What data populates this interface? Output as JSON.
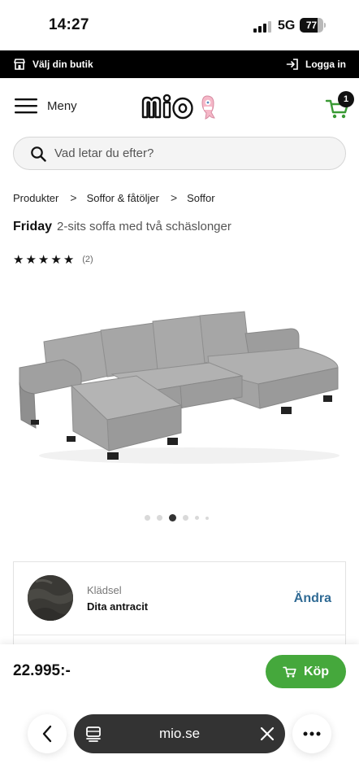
{
  "status_bar": {
    "time": "14:27",
    "network": "5G",
    "battery": "77",
    "battery_level": 0.77
  },
  "topbar": {
    "store_label": "Välj din butik",
    "store_icon": "store-icon",
    "login_label": "Logga in",
    "login_icon": "login-icon"
  },
  "header": {
    "menu_label": "Meny",
    "menu_icon": "hamburger-icon",
    "logo_text": "mio",
    "cart_icon": "cart-icon",
    "cart_count": "1"
  },
  "search": {
    "placeholder": "Vad letar du efter?",
    "icon": "search-icon"
  },
  "breadcrumb": {
    "items": [
      "Produkter",
      "Soffor & fåtöljer",
      "Soffor"
    ],
    "separator": ">"
  },
  "product": {
    "name": "Friday",
    "description": "2-sits soffa med två schäslonger",
    "rating": 5,
    "stars": "★",
    "review_count": "(2)",
    "image_icon": "sofa-image",
    "images_total": 6,
    "active_image_index": 2
  },
  "fabric": {
    "label": "Klädsel",
    "value": "Dita antracit",
    "change_label": "Ändra"
  },
  "purchase": {
    "price": "22.995:-",
    "buy_label": "Köp",
    "buy_icon": "cart-icon",
    "accent_color": "#45a83c"
  },
  "browser": {
    "url": "mio.se",
    "back_icon": "chevron-left-icon",
    "tabs_icon": "tabs-icon",
    "close_icon": "close-icon",
    "more_icon": "more-icon"
  }
}
